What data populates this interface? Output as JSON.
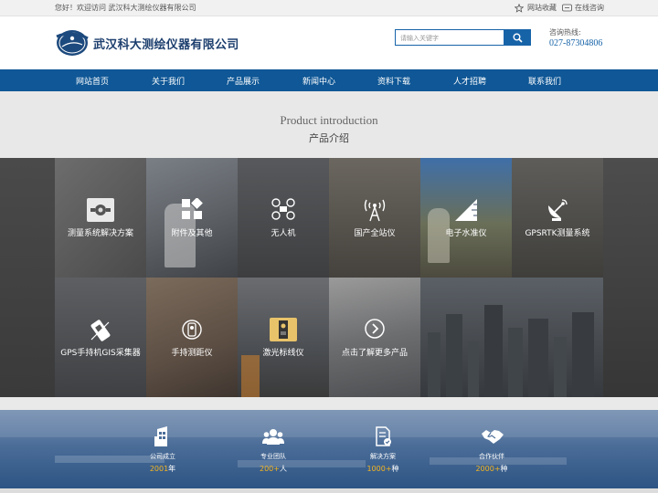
{
  "topbar": {
    "welcome": "您好！欢迎访问 武汉科大测绘仪器有限公司",
    "bookmark": "网站收藏",
    "consult": "在线咨询"
  },
  "header": {
    "company": "武汉科大测绘仪器有限公司",
    "search_placeholder": "请输入关键字",
    "hotline_label": "咨询热线:",
    "hotline": "027-87304806"
  },
  "nav": [
    {
      "label": "网站首页"
    },
    {
      "label": "关于我们"
    },
    {
      "label": "产品展示"
    },
    {
      "label": "新闻中心"
    },
    {
      "label": "资料下载"
    },
    {
      "label": "人才招聘"
    },
    {
      "label": "联系我们"
    }
  ],
  "section": {
    "title_en": "Product introduction",
    "title_cn": "产品介绍"
  },
  "products": [
    {
      "label": "测量系统解决方案",
      "icon": "surveying-system-icon"
    },
    {
      "label": "附件及其他",
      "icon": "grid-blocks-icon"
    },
    {
      "label": "无人机",
      "icon": "drone-icon"
    },
    {
      "label": "国产全站仪",
      "icon": "antenna-tower-icon"
    },
    {
      "label": "电子水准仪",
      "icon": "triangle-ruler-icon"
    },
    {
      "label": "GPSRTK测量系统",
      "icon": "satellite-dish-icon"
    },
    {
      "label": "GPS手持机GIS采集器",
      "icon": "handheld-gps-icon"
    },
    {
      "label": "手持测距仪",
      "icon": "rangefinder-icon"
    },
    {
      "label": "激光标线仪",
      "icon": "laser-level-icon"
    },
    {
      "label": "点击了解更多产品",
      "icon": "arrow-circle-icon"
    }
  ],
  "stats": [
    {
      "title": "公司成立",
      "value": "2001",
      "unit": "年",
      "icon": "building-icon"
    },
    {
      "title": "专业团队",
      "value": "200+",
      "unit": "人",
      "icon": "team-icon"
    },
    {
      "title": "解决方案",
      "value": "1000+",
      "unit": "种",
      "icon": "document-check-icon"
    },
    {
      "title": "合作伙伴",
      "value": "2000+",
      "unit": "种",
      "icon": "handshake-icon"
    }
  ],
  "colors": {
    "brand_blue": "#0f5796",
    "accent_blue": "#1763a8",
    "stat_number": "#f5b51f"
  }
}
